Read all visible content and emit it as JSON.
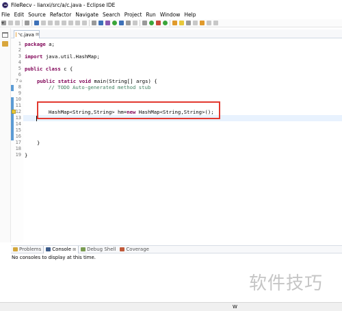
{
  "window": {
    "title": "FileRecv - lianxi/src/a/c.java - Eclipse IDE"
  },
  "menu": [
    "File",
    "Edit",
    "Source",
    "Refactor",
    "Navigate",
    "Search",
    "Project",
    "Run",
    "Window",
    "Help"
  ],
  "editor": {
    "tab_label": "*c.java",
    "tab_close": "⊠",
    "line_numbers": [
      "1",
      "2",
      "3",
      "4",
      "5",
      "6",
      "7",
      "8",
      "9",
      "10",
      "11",
      "12",
      "13",
      "14",
      "15",
      "16",
      "17",
      "18",
      "19"
    ],
    "code": {
      "l1_kw": "package",
      "l1_rest": " a;",
      "l3_kw": "import",
      "l3_rest": " java.util.HashMap;",
      "l5_kw": "public class",
      "l5_rest": " c {",
      "l7_kw": "public static void",
      "l7_rest": " main(String[] args) {",
      "l8_comment": "// TODO Auto-generated method stub",
      "l11_a": "HashMap<String,String> hm=",
      "l11_kw": "new",
      "l11_b": " HashMap<String,String>();",
      "l16": "}",
      "l18": "}"
    }
  },
  "bottom_panel": {
    "tabs": [
      {
        "label": "Problems"
      },
      {
        "label": "Console",
        "close": "⊠"
      },
      {
        "label": "Debug Shell"
      },
      {
        "label": "Coverage"
      }
    ],
    "console_message": "No consoles to display at this time."
  },
  "status": {
    "right_text": "W"
  },
  "watermark": "软件技巧"
}
